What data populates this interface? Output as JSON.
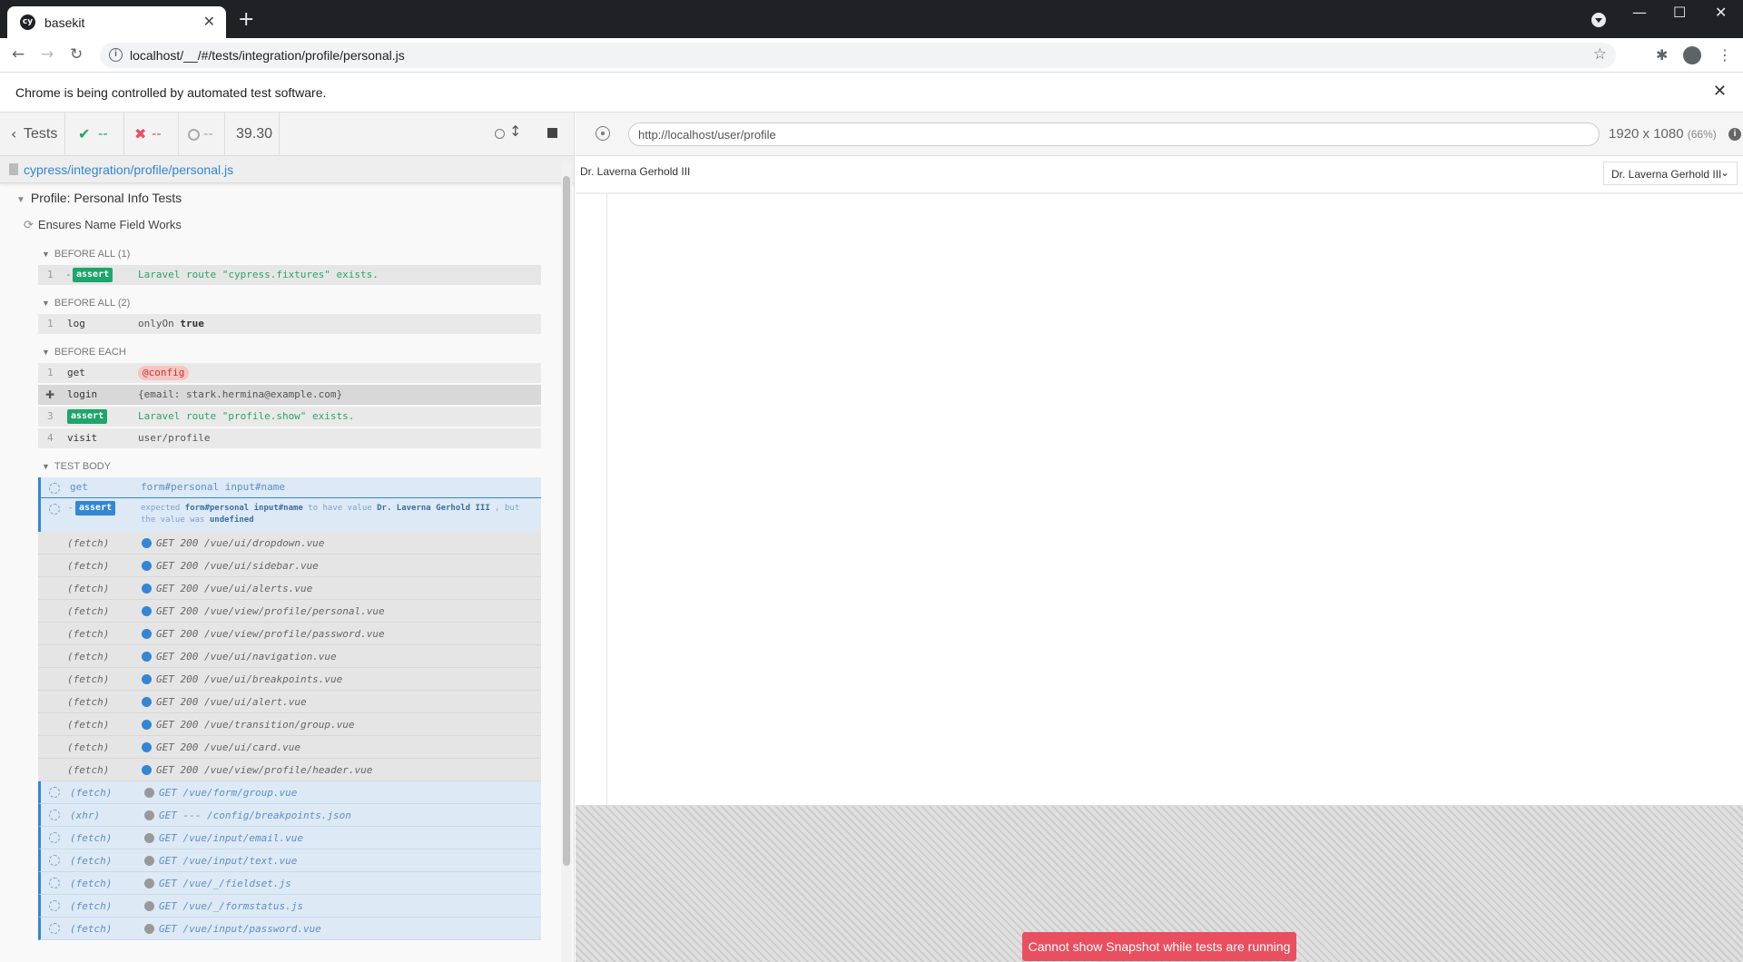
{
  "browser": {
    "tab_title": "basekit",
    "favicon": "cy",
    "url": "localhost/__/#/tests/integration/profile/personal.js",
    "infobar": "Chrome is being controlled by automated test software."
  },
  "runner": {
    "back_label": "Tests",
    "passed": "--",
    "failed": "--",
    "pending": "--",
    "duration": "39.30",
    "spec_path": "cypress/integration/profile/personal.js",
    "suite": "Profile: Personal Info Tests",
    "test": "Ensures Name Field Works"
  },
  "hooks": [
    "BEFORE ALL (1)",
    "BEFORE ALL (2)",
    "BEFORE EACH",
    "TEST BODY"
  ],
  "commands": {
    "ba1": {
      "num": "1",
      "dash": "-",
      "badge": "assert",
      "msg": "Laravel route \"cypress.fixtures\" exists."
    },
    "ba2": {
      "num": "1",
      "name": "log",
      "msg": "onlyOn",
      "val": "true"
    },
    "be1": {
      "num": "1",
      "name": "get",
      "alias": "@config"
    },
    "be2": {
      "name": "login",
      "msg": "{email: stark.hermina@example.com}"
    },
    "be3": {
      "num": "3",
      "badge": "assert",
      "msg": "Laravel route \"profile.show\" exists."
    },
    "be4": {
      "num": "4",
      "name": "visit",
      "msg": "user/profile"
    },
    "tb1": {
      "name": "get",
      "msg": "form#personal input#name"
    },
    "tb2": {
      "dash": "-",
      "badge": "assert",
      "w1": "expected",
      "w2": "form#personal input#name",
      "w3": "to have value",
      "w4": "Dr. Laverna Gerhold III",
      "w5": ", but",
      "w6": "the value was",
      "w7": "undefined"
    }
  },
  "requests": [
    {
      "kind": "(fetch)",
      "text": "GET 200 /vue/ui/dropdown.vue",
      "state": "done"
    },
    {
      "kind": "(fetch)",
      "text": "GET 200 /vue/ui/sidebar.vue",
      "state": "done"
    },
    {
      "kind": "(fetch)",
      "text": "GET 200 /vue/ui/alerts.vue",
      "state": "done"
    },
    {
      "kind": "(fetch)",
      "text": "GET 200 /vue/view/profile/personal.vue",
      "state": "done"
    },
    {
      "kind": "(fetch)",
      "text": "GET 200 /vue/view/profile/password.vue",
      "state": "done"
    },
    {
      "kind": "(fetch)",
      "text": "GET 200 /vue/ui/navigation.vue",
      "state": "done"
    },
    {
      "kind": "(fetch)",
      "text": "GET 200 /vue/ui/breakpoints.vue",
      "state": "done"
    },
    {
      "kind": "(fetch)",
      "text": "GET 200 /vue/ui/alert.vue",
      "state": "done"
    },
    {
      "kind": "(fetch)",
      "text": "GET 200 /vue/transition/group.vue",
      "state": "done"
    },
    {
      "kind": "(fetch)",
      "text": "GET 200 /vue/ui/card.vue",
      "state": "done"
    },
    {
      "kind": "(fetch)",
      "text": "GET 200 /vue/view/profile/header.vue",
      "state": "done"
    },
    {
      "kind": "(fetch)",
      "text": "GET /vue/form/group.vue",
      "state": "pending"
    },
    {
      "kind": "(xhr)",
      "text": "GET --- /config/breakpoints.json",
      "state": "pending"
    },
    {
      "kind": "(fetch)",
      "text": "GET /vue/input/email.vue",
      "state": "pending"
    },
    {
      "kind": "(fetch)",
      "text": "GET /vue/input/text.vue",
      "state": "pending"
    },
    {
      "kind": "(fetch)",
      "text": "GET /vue/_/fieldset.js",
      "state": "pending"
    },
    {
      "kind": "(fetch)",
      "text": "GET /vue/_/formstatus.js",
      "state": "pending"
    },
    {
      "kind": "(fetch)",
      "text": "GET /vue/input/password.vue",
      "state": "pending"
    }
  ],
  "aut": {
    "url": "http://localhost/user/profile",
    "viewport": "1920 x 1080",
    "scale": "(66%)",
    "user_name": "Dr. Laverna Gerhold III",
    "dropdown": "Dr. Laverna Gerhold III",
    "snapshot_msg": "Cannot show Snapshot while tests are running"
  },
  "colors": {
    "passed": "#1ea56b",
    "failed": "#e94f5f",
    "pending_blue": "#3386d4"
  }
}
